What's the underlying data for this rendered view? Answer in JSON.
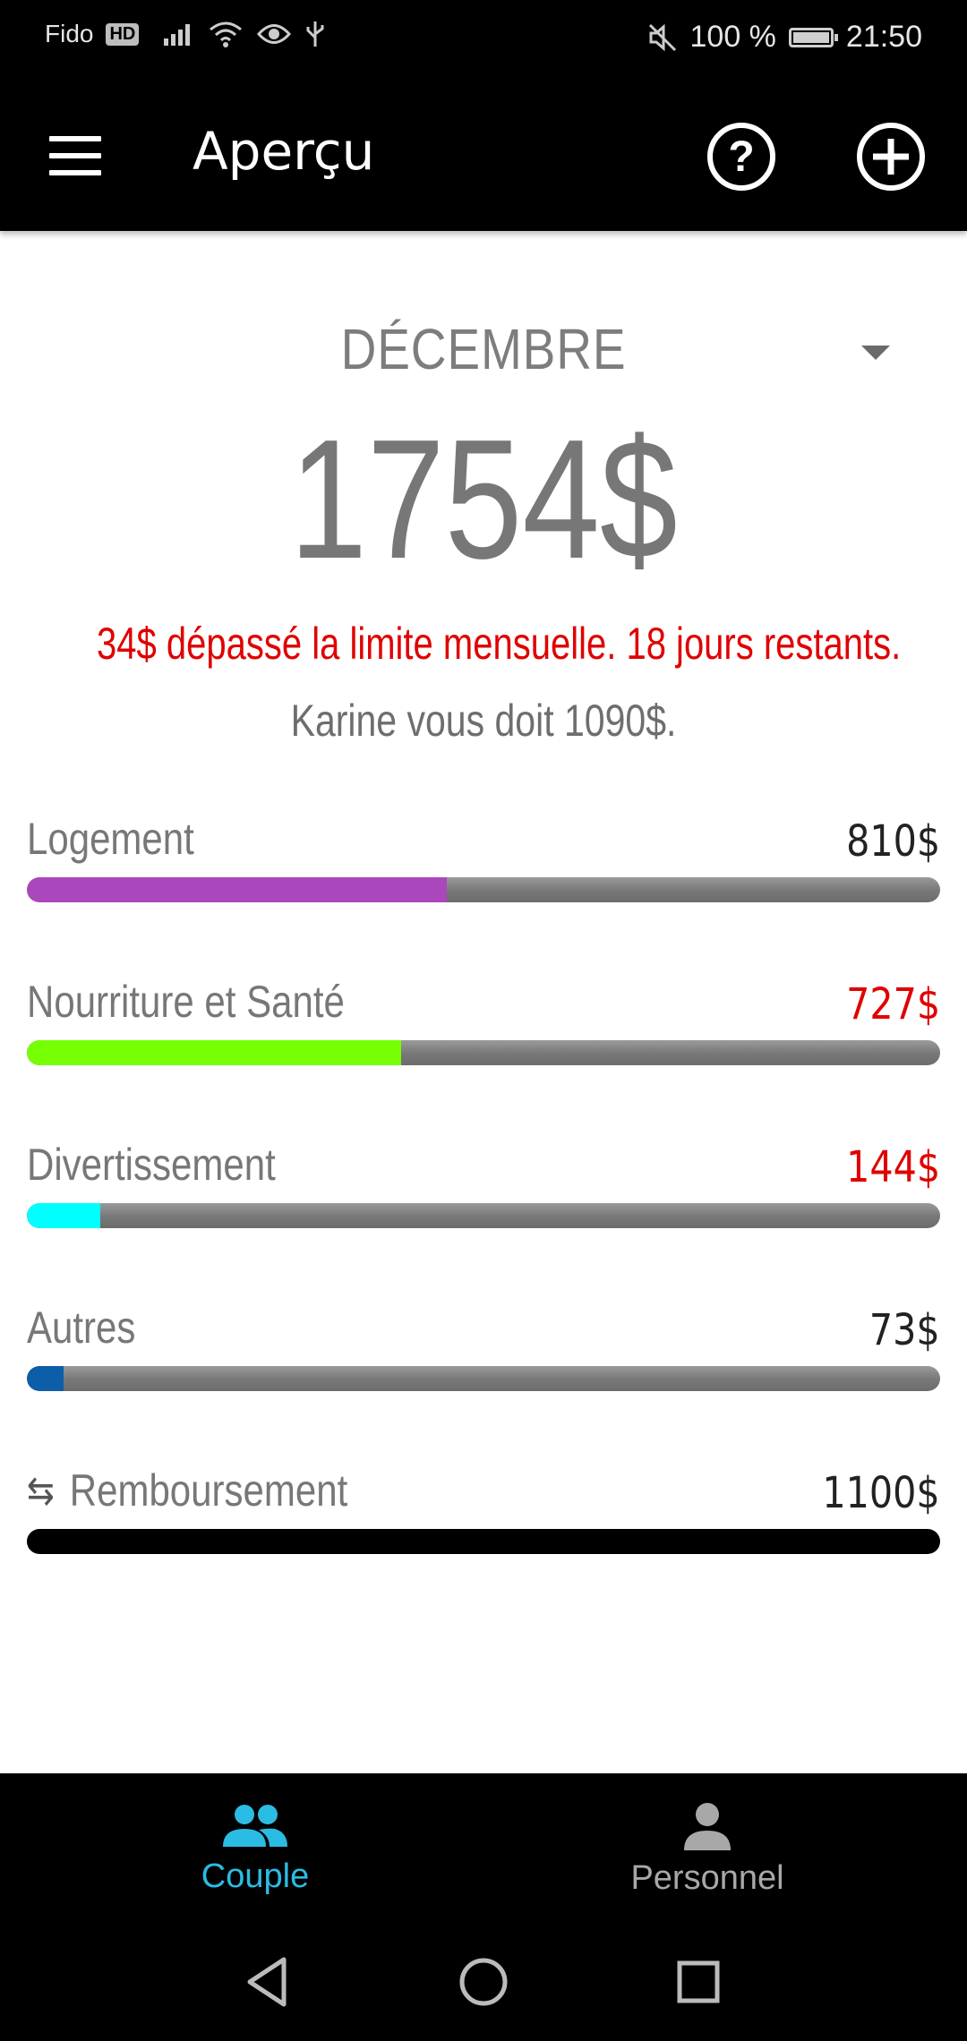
{
  "statusbar": {
    "carrier": "Fido",
    "hd": "HD",
    "battery": "100 %",
    "time": "21:50"
  },
  "appbar": {
    "title": "Aperçu",
    "icons": [
      "menu-icon",
      "help-icon",
      "add-icon"
    ]
  },
  "overview": {
    "month": "DÉCEMBRE",
    "total": "1754$",
    "alert": "34$ dépassé la limite mensuelle. 18 jours restants.",
    "debt_message": "Karine vous doit 1090$."
  },
  "categories": [
    {
      "label": "Logement",
      "amount": "810$",
      "over": false,
      "progress": 0.46,
      "color": "#ab47bc"
    },
    {
      "label": "Nourriture et Santé",
      "amount": "727$",
      "over": true,
      "progress": 0.41,
      "color": "#76ff03"
    },
    {
      "label": "Divertissement",
      "amount": "144$",
      "over": true,
      "progress": 0.08,
      "color": "#00ffff"
    },
    {
      "label": "Autres",
      "amount": "73$",
      "over": false,
      "progress": 0.04,
      "color": "#0d5ea8"
    }
  ],
  "reimbursement": {
    "label": "Remboursement",
    "amount": "1100$",
    "icon": "swap-arrows-icon",
    "color": "#000000"
  },
  "bottomnav": {
    "tabs": [
      {
        "label": "Couple",
        "icon": "group-icon",
        "active": true
      },
      {
        "label": "Personnel",
        "icon": "person-icon",
        "active": false
      }
    ]
  },
  "colors": {
    "accent": "#2bbce4",
    "alert": "#e00000"
  }
}
